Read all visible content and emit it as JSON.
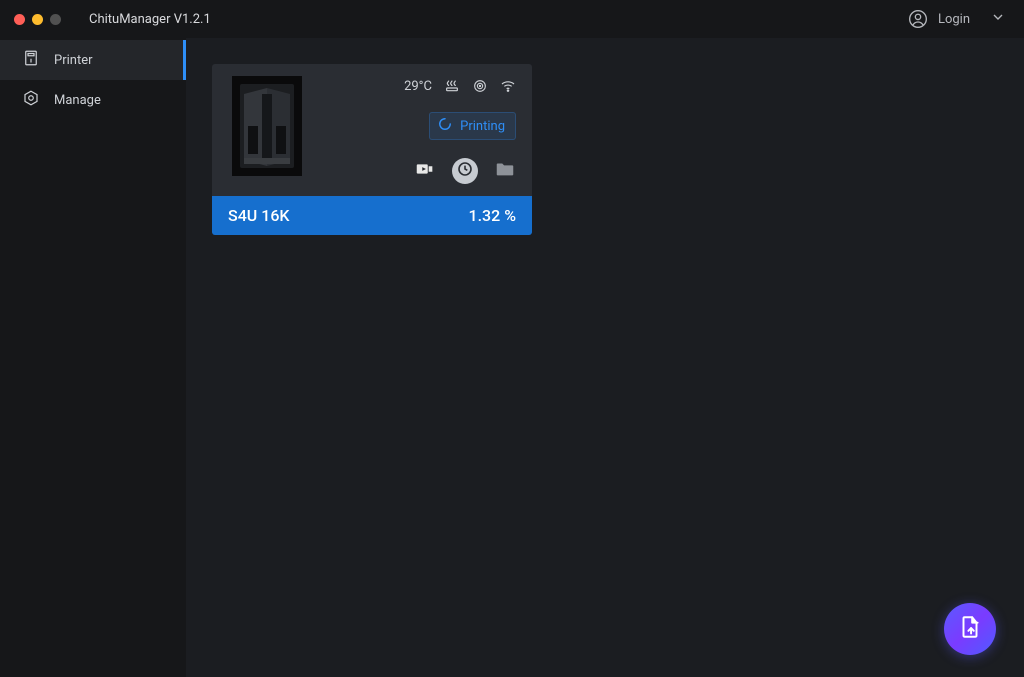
{
  "app": {
    "title": "ChituManager V1.2.1"
  },
  "header": {
    "login_label": "Login"
  },
  "sidebar": {
    "items": [
      {
        "label": "Printer",
        "icon": "printer-icon",
        "active": true
      },
      {
        "label": "Manage",
        "icon": "settings-hex-icon",
        "active": false
      }
    ]
  },
  "printer": {
    "temperature": "29°C",
    "status_label": "Printing",
    "name": "S4U 16K",
    "progress_label": "1.32 %"
  },
  "colors": {
    "accent": "#2e8ef7",
    "card_bottom": "#166fce",
    "fab_gradient_a": "#5a5bff",
    "fab_gradient_b": "#7a3bff"
  }
}
